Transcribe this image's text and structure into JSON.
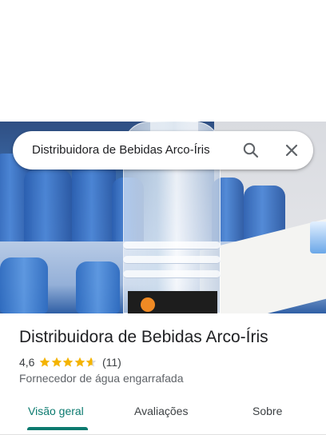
{
  "search": {
    "query": "Distribuidora de Bebidas Arco-Íris",
    "search_icon": "search-icon",
    "close_icon": "close-icon"
  },
  "place": {
    "name": "Distribuidora de Bebidas Arco-Íris",
    "rating": "4,6",
    "rating_value": 4.6,
    "stars_max": 5,
    "review_count": "(11)",
    "category": "Fornecedor de água engarrafada",
    "star_color": "#f4b400"
  },
  "tabs": [
    {
      "label": "Visão geral",
      "active": true
    },
    {
      "label": "Avaliações",
      "active": false
    },
    {
      "label": "Sobre",
      "active": false
    }
  ],
  "colors": {
    "accent": "#0b7a6f",
    "text_primary": "#202124",
    "text_secondary": "#5f6368"
  }
}
